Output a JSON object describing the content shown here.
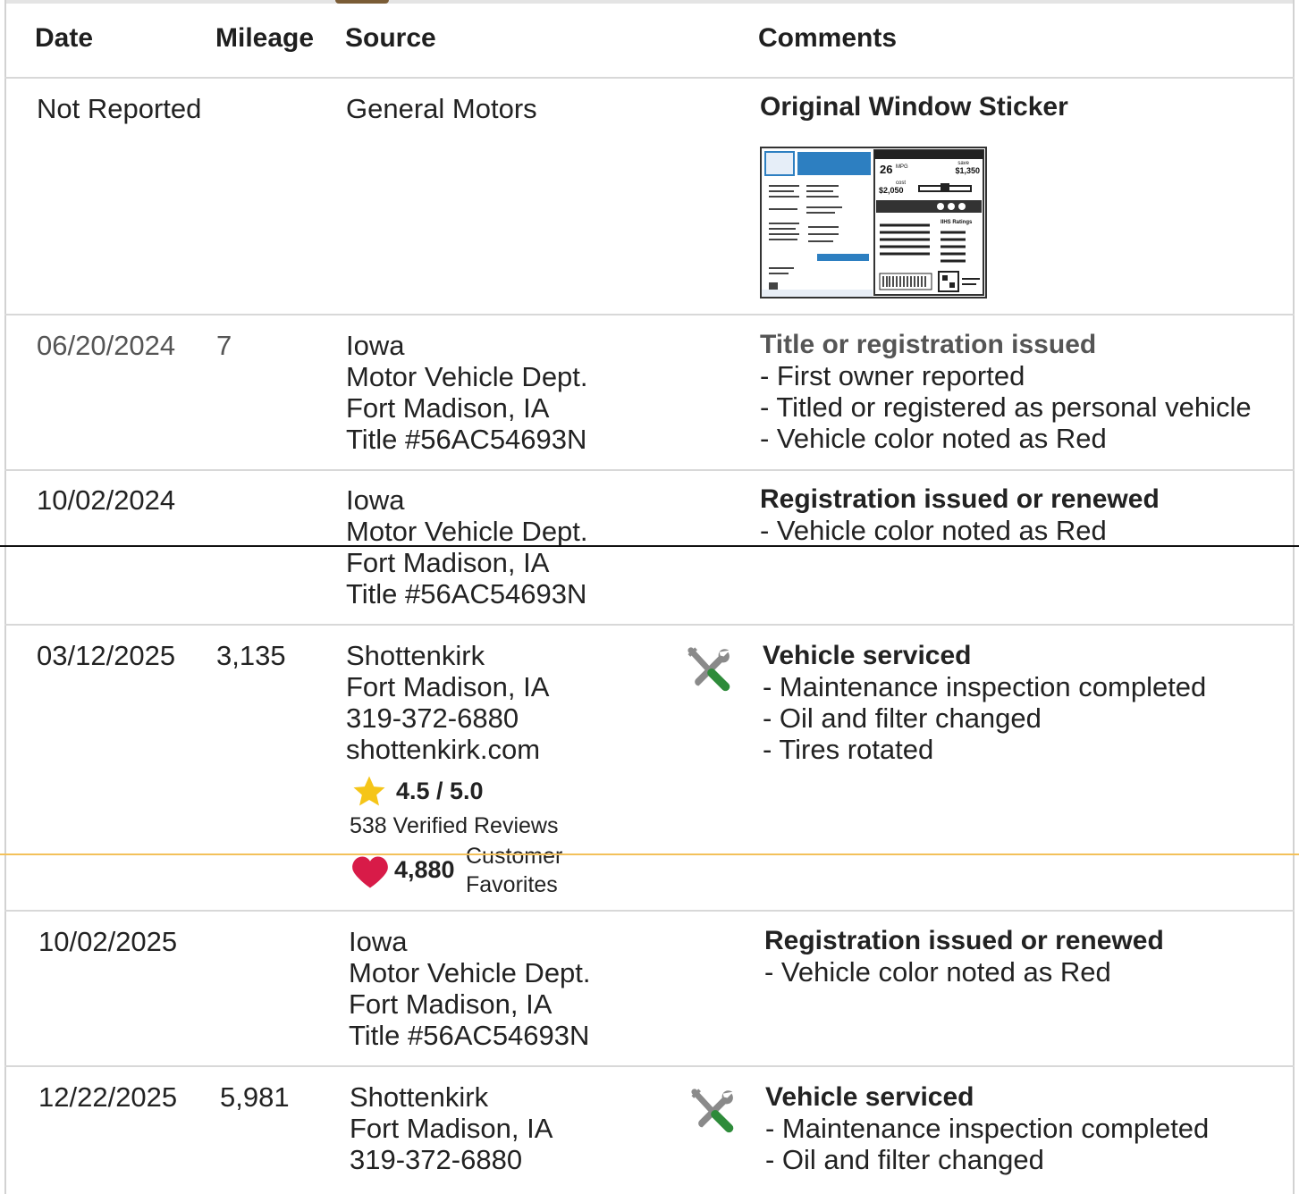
{
  "header": {
    "date": "Date",
    "mileage": "Mileage",
    "source": "Source",
    "comments": "Comments"
  },
  "rows": [
    {
      "date": "Not Reported",
      "mileage": "",
      "source": [
        "General Motors"
      ],
      "comment_title": "Original Window Sticker",
      "comment_lines": [],
      "sticker": {
        "mpg": "26",
        "mpg_unit": "MPG",
        "save_label": "save",
        "save": "$1,350",
        "cost_label": "cost",
        "cost": "$2,050",
        "iihs": "IIHS Ratings"
      }
    },
    {
      "date": "06/20/2024",
      "mileage": "7",
      "source": [
        "Iowa",
        "Motor Vehicle Dept.",
        "Fort Madison, IA",
        "Title #56AC54693N"
      ],
      "comment_title": "Title or registration issued",
      "comment_lines": [
        "- First owner reported",
        "- Titled or registered as personal vehicle",
        "- Vehicle color noted as Red"
      ]
    },
    {
      "date": "10/02/2024",
      "mileage": "",
      "source": [
        "Iowa",
        "Motor Vehicle Dept.",
        "Fort Madison, IA",
        "Title #56AC54693N"
      ],
      "comment_title": "Registration issued or renewed",
      "comment_lines": [
        "- Vehicle color noted as Red"
      ]
    },
    {
      "date": "03/12/2025",
      "mileage": "3,135",
      "source": [
        "Shottenkirk",
        "Fort Madison, IA",
        "319-372-6880",
        "shottenkirk.com"
      ],
      "rating": "4.5 / 5.0",
      "reviews": "538 Verified Reviews",
      "favorites_count": "4,880",
      "favorites_label_1": "Customer",
      "favorites_label_2": "Favorites",
      "comment_title": "Vehicle serviced",
      "comment_lines": [
        "- Maintenance inspection completed",
        "- Oil and filter changed",
        "- Tires rotated"
      ]
    },
    {
      "date": "10/02/2025",
      "mileage": "",
      "source": [
        "Iowa",
        "Motor Vehicle Dept.",
        "Fort Madison, IA",
        "Title #56AC54693N"
      ],
      "comment_title": "Registration issued or renewed",
      "comment_lines": [
        "- Vehicle color noted as Red"
      ]
    },
    {
      "date": "12/22/2025",
      "mileage": "5,981",
      "source": [
        "Shottenkirk",
        "Fort Madison, IA",
        "319-372-6880"
      ],
      "comment_title": "Vehicle serviced",
      "comment_lines": [
        "- Maintenance inspection completed",
        "- Oil and filter changed"
      ]
    }
  ],
  "colors": {
    "service_icon_handle": "#2e8b3a",
    "star": "#f5c518",
    "heart": "#d81b48"
  }
}
